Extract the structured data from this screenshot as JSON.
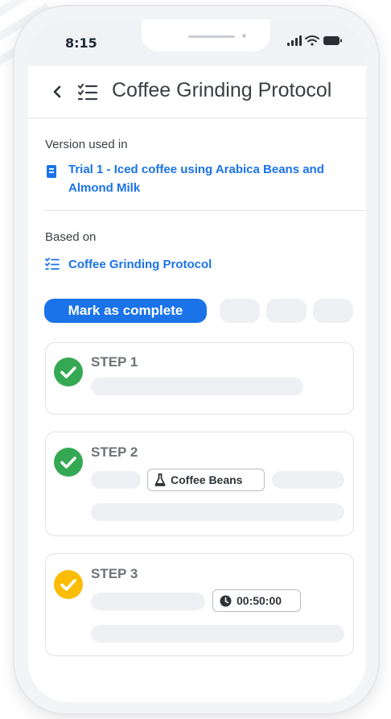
{
  "status_bar": {
    "time": "8:15"
  },
  "header": {
    "title": "Coffee Grinding Protocol",
    "back_icon": "chevron-left-icon",
    "title_icon": "checklist-icon"
  },
  "version_section": {
    "label": "Version used in",
    "link_line1": "Trial 1 - Iced coffee using Arabica Beans and",
    "link_line2": "Almond Milk",
    "icon": "document-icon"
  },
  "based_on_section": {
    "label": "Based on",
    "link": "Coffee Grinding Protocol",
    "icon": "checklist-icon"
  },
  "actions": {
    "mark_complete_label": "Mark as complete"
  },
  "steps": [
    {
      "label": "STEP 1",
      "status": "complete",
      "status_color": "#34a853"
    },
    {
      "label": "STEP 2",
      "status": "complete",
      "status_color": "#34a853",
      "tag_label": "Coffee Beans",
      "tag_icon": "flask-icon"
    },
    {
      "label": "STEP 3",
      "status": "in-progress",
      "status_color": "#fbbc04",
      "timer_value": "00:50:00",
      "timer_icon": "clock-icon"
    }
  ],
  "colors": {
    "accent": "#1a73e8",
    "complete": "#34a853",
    "pending": "#fbbc04"
  }
}
